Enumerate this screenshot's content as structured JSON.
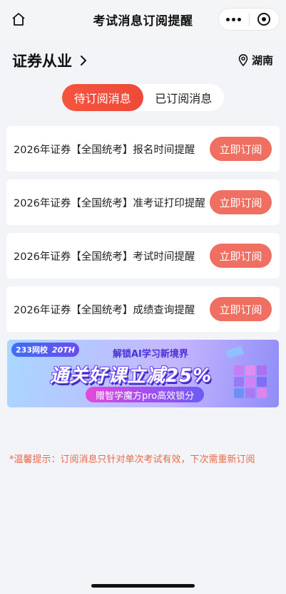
{
  "nav": {
    "title": "考试消息订阅提醒"
  },
  "header": {
    "category": "证券从业",
    "location": "湖南"
  },
  "tabs": [
    {
      "label": "待订阅消息",
      "active": true
    },
    {
      "label": "已订阅消息",
      "active": false
    }
  ],
  "items": [
    {
      "title": "2026年证券【全国统考】报名时间提醒",
      "button": "立即订阅"
    },
    {
      "title": "2026年证券【全国统考】准考证打印提醒",
      "button": "立即订阅"
    },
    {
      "title": "2026年证券【全国统考】考试时间提醒",
      "button": "立即订阅"
    },
    {
      "title": "2026年证券【全国统考】成绩查询提醒",
      "button": "立即订阅"
    }
  ],
  "banner": {
    "logo": "233网校",
    "anniversary": "20TH",
    "tagline": "解锁AI学习新境界",
    "headline": "通关好课立减25%",
    "pill": "赠智学魔方pro高效锁分"
  },
  "notice": "*温馨提示：订阅消息只针对单次考试有效，下次需重新订阅",
  "colors": {
    "accent": "#f04e3c",
    "button": "#ef6f62",
    "notice": "#e86a4a",
    "background": "#f2f4f8"
  }
}
